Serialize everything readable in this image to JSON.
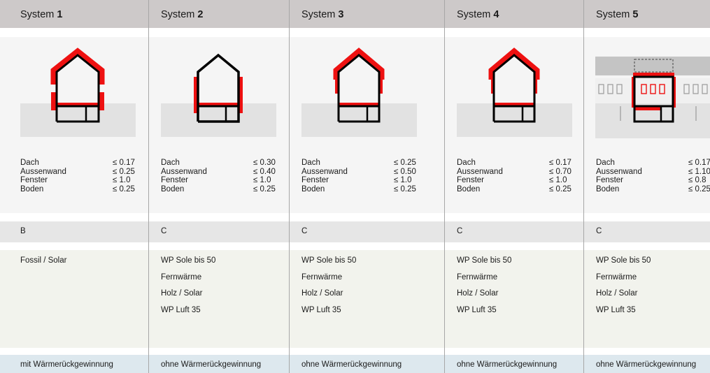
{
  "systems": [
    {
      "title_prefix": "System ",
      "number": "1",
      "uvalues": [
        {
          "label": "Dach",
          "value": "≤ 0.17"
        },
        {
          "label": "Aussenwand",
          "value": "≤ 0.25"
        },
        {
          "label": "Fenster",
          "value": "≤ 1.0"
        },
        {
          "label": "Boden",
          "value": "≤ 0.25"
        }
      ],
      "klasse": "B",
      "heizung": [
        "Fossil / Solar"
      ],
      "lueftung": "mit Wärmerückgewinnung"
    },
    {
      "title_prefix": "System ",
      "number": "2",
      "uvalues": [
        {
          "label": "Dach",
          "value": "≤ 0.30"
        },
        {
          "label": "Aussenwand",
          "value": "≤ 0.40"
        },
        {
          "label": "Fenster",
          "value": "≤ 1.0"
        },
        {
          "label": "Boden",
          "value": "≤ 0.25"
        }
      ],
      "klasse": "C",
      "heizung": [
        "WP Sole bis 50",
        "Fernwärme",
        "Holz / Solar",
        "WP Luft 35"
      ],
      "lueftung": "ohne Wärmerückgewinnung"
    },
    {
      "title_prefix": "System ",
      "number": "3",
      "uvalues": [
        {
          "label": "Dach",
          "value": "≤ 0.25"
        },
        {
          "label": "Aussenwand",
          "value": "≤ 0.50"
        },
        {
          "label": "Fenster",
          "value": "≤ 1.0"
        },
        {
          "label": "Boden",
          "value": "≤ 0.25"
        }
      ],
      "klasse": "C",
      "heizung": [
        "WP Sole bis 50",
        "Fernwärme",
        "Holz / Solar",
        "WP Luft 35"
      ],
      "lueftung": "ohne Wärmerückgewinnung"
    },
    {
      "title_prefix": "System ",
      "number": "4",
      "uvalues": [
        {
          "label": "Dach",
          "value": "≤ 0.17"
        },
        {
          "label": "Aussenwand",
          "value": "≤ 0.70"
        },
        {
          "label": "Fenster",
          "value": "≤ 1.0"
        },
        {
          "label": "Boden",
          "value": "≤ 0.25"
        }
      ],
      "klasse": "C",
      "heizung": [
        "WP Sole bis 50",
        "Fernwärme",
        "Holz / Solar",
        "WP Luft 35"
      ],
      "lueftung": "ohne Wärmerückgewinnung"
    },
    {
      "title_prefix": "System ",
      "number": "5",
      "uvalues": [
        {
          "label": "Dach",
          "value": "≤ 0.17"
        },
        {
          "label": "Aussenwand",
          "value": "≤ 1.10"
        },
        {
          "label": "Fenster",
          "value": "≤ 0.8"
        },
        {
          "label": "Boden",
          "value": "≤ 0.25"
        }
      ],
      "klasse": "C",
      "heizung": [
        "WP Sole bis 50",
        "Fernwärme",
        "Holz / Solar",
        "WP Luft 35"
      ],
      "lueftung": "ohne Wärmerückgewinnung"
    }
  ],
  "colors": {
    "insulation": "#ee1111",
    "outline": "#000000",
    "ground": "#e2e2e2",
    "neighbor": "#c4c4c4"
  }
}
